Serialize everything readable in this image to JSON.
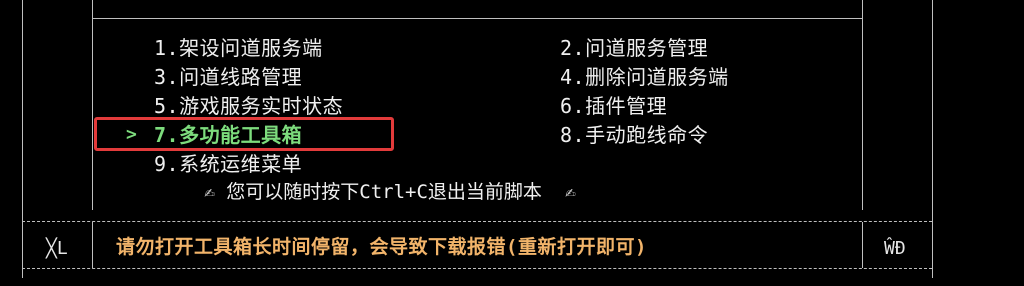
{
  "menu": {
    "left": [
      {
        "label": "1.架设问道服务端"
      },
      {
        "label": "3.问道线路管理"
      },
      {
        "label": "5.游戏服务实时状态"
      },
      {
        "label": "7.多功能工具箱"
      },
      {
        "label": "9.系统运维菜单"
      }
    ],
    "right": [
      {
        "label": "2.问道服务管理"
      },
      {
        "label": "4.删除问道服务端"
      },
      {
        "label": "6.插件管理"
      },
      {
        "label": "8.手动跑线命令"
      }
    ],
    "selected_index": 3,
    "selected_marker": ">"
  },
  "hint": {
    "icon_left": "✍",
    "text": "您可以随时按下Ctrl+C退出当前脚本",
    "icon_right": "✍"
  },
  "footer": {
    "left_label": "╳L",
    "warning": "请勿打开工具箱长时间停留，会导致下载报错(重新打开即可)",
    "right_label": "ŴĐ"
  },
  "colors": {
    "background": "#000000",
    "selected": "#7ddc7d",
    "warning": "#f2b46a",
    "highlight_box": "#e23b3b"
  }
}
